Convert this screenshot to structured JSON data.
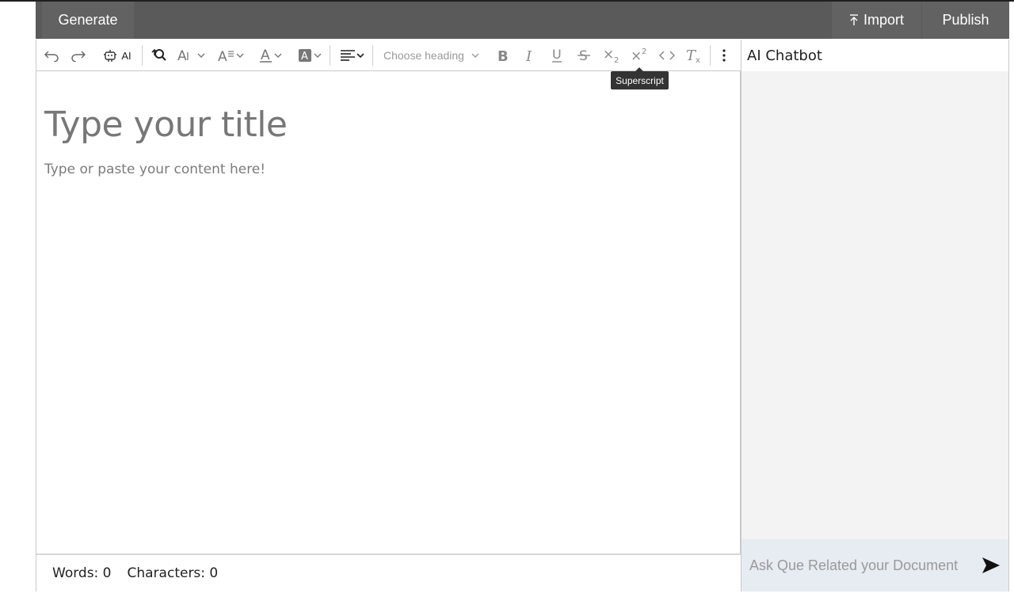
{
  "topbar": {
    "generate_label": "Generate",
    "import_label": "Import",
    "publish_label": "Publish"
  },
  "toolbar": {
    "ai_label": "AI",
    "heading_placeholder": "Choose heading",
    "tooltip": "Superscript",
    "icons": [
      "undo-icon",
      "redo-icon",
      "ai-robot-icon",
      "find-replace-icon",
      "font-size-icon",
      "line-height-icon",
      "font-color-icon",
      "background-color-icon",
      "align-icon",
      "bold-icon",
      "italic-icon",
      "underline-icon",
      "strikethrough-icon",
      "subscript-icon",
      "superscript-icon",
      "code-icon",
      "remove-format-icon",
      "more-vertical-icon"
    ]
  },
  "editor": {
    "title_placeholder": "Type your title",
    "body_placeholder": "Type or paste your content here!"
  },
  "status": {
    "words": "Words: 0",
    "characters": "Characters: 0"
  },
  "chat": {
    "title": "AI Chatbot",
    "input_placeholder": "Ask Que Related your Document"
  }
}
